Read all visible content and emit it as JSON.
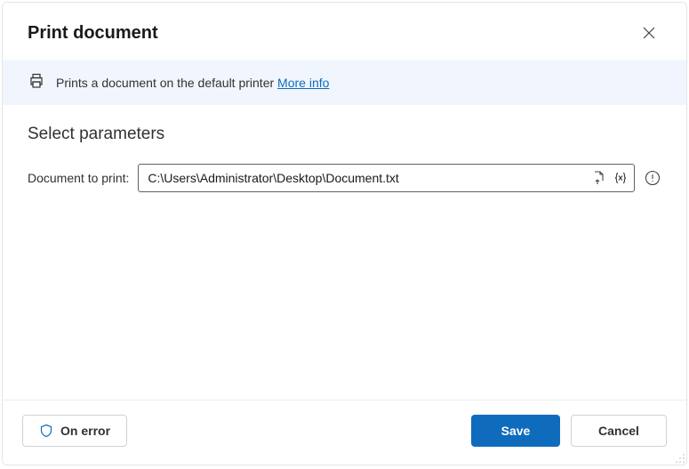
{
  "header": {
    "title": "Print document"
  },
  "banner": {
    "text": "Prints a document on the default printer ",
    "link": "More info"
  },
  "params": {
    "section_title": "Select parameters",
    "document_label": "Document to print:",
    "document_value": "C:\\Users\\Administrator\\Desktop\\Document.txt"
  },
  "footer": {
    "on_error": "On error",
    "save": "Save",
    "cancel": "Cancel"
  }
}
